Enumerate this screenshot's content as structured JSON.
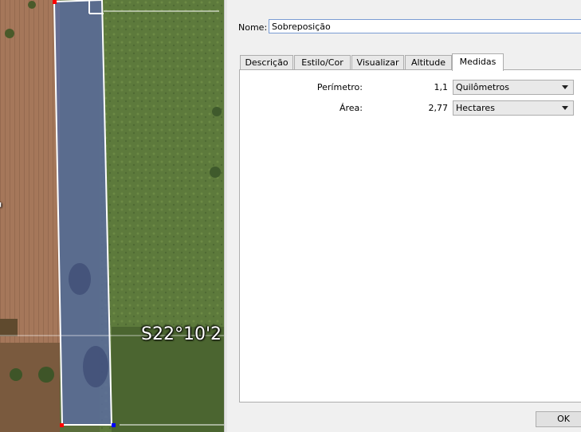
{
  "map": {
    "coordinate_label": "S22°10'2",
    "left_label": "\""
  },
  "dialog": {
    "name_label": "Nome:",
    "name_value": "Sobreposição",
    "tabs": [
      {
        "label": "Descrição",
        "active": false
      },
      {
        "label": "Estilo/Cor",
        "active": false
      },
      {
        "label": "Visualizar",
        "active": false
      },
      {
        "label": "Altitude",
        "active": false
      },
      {
        "label": "Medidas",
        "active": true
      }
    ],
    "measures": {
      "perimeter_label": "Perímetro:",
      "perimeter_value": "1,1",
      "perimeter_unit": "Quilômetros",
      "area_label": "Área:",
      "area_value": "2,77",
      "area_unit": "Hectares"
    },
    "ok_label": "OK"
  },
  "colors": {
    "polygon_fill": "#5a6c9e",
    "polygon_stroke": "#ffffff",
    "vertex_red": "#ff0000",
    "vertex_blue": "#0000ff",
    "tab_border": "#adadad"
  }
}
